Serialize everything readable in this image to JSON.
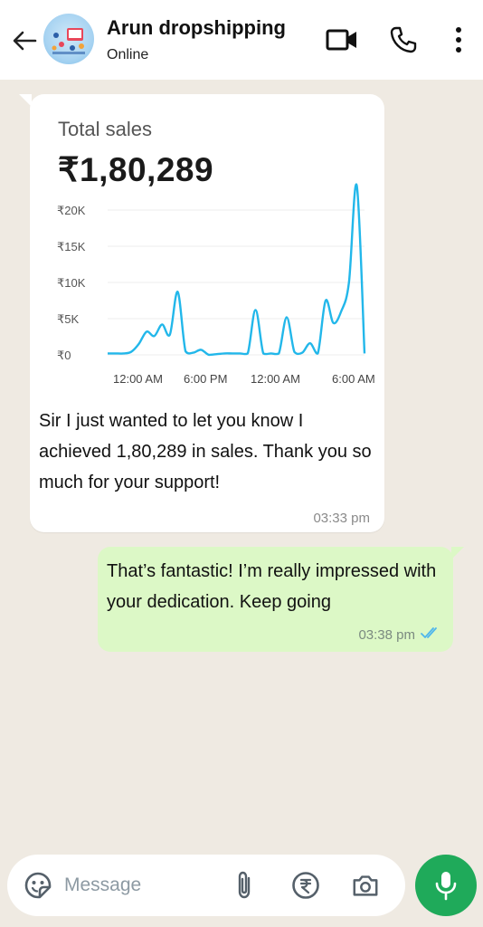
{
  "header": {
    "title": "Arun dropshipping",
    "status": "Online"
  },
  "incoming": {
    "card_title": "Total sales",
    "card_total": "₹1,80,289",
    "text": "Sir I just wanted to let you know I achieved 1,80,289 in sales. Thank you so much for your support!",
    "time": "03:33 pm"
  },
  "outgoing": {
    "text": "That’s fantastic! I’m really impressed with your dedication. Keep going",
    "time": "03:38 pm"
  },
  "input": {
    "placeholder": "Message"
  },
  "colors": {
    "line": "#22b7ea",
    "accent_green": "#1faa5a",
    "outgoing_bubble": "#dcf8c6",
    "ticks": "#4fb6ec"
  },
  "chart_data": {
    "type": "line",
    "y_tick_labels": [
      "₹20K",
      "₹15K",
      "₹10K",
      "₹5K",
      "₹0"
    ],
    "x_tick_labels": [
      "12:00 AM",
      "6:00 PM",
      "12:00 AM",
      "6:00 AM"
    ],
    "ylim": [
      0,
      20000
    ],
    "grid": true,
    "series": [
      {
        "values": [
          200,
          200,
          200,
          400,
          1500,
          3200,
          2600,
          4200,
          2800,
          8700,
          500,
          300,
          700,
          0,
          100,
          200,
          200,
          200,
          200,
          6200,
          200,
          200,
          200,
          5200,
          400,
          300,
          1600,
          200,
          7500,
          4400,
          6000,
          10000,
          23400,
          200
        ]
      }
    ]
  }
}
